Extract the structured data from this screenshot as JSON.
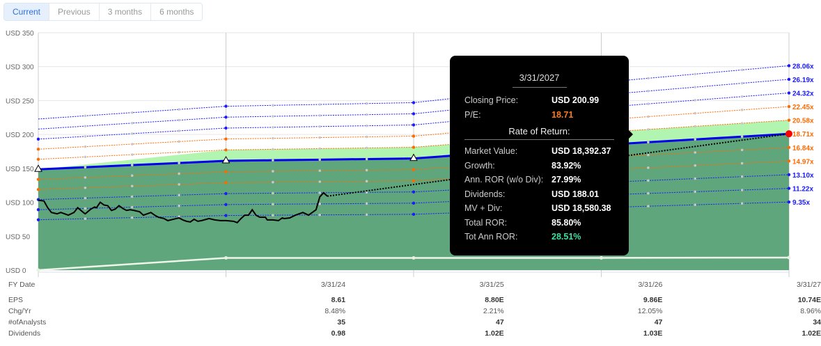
{
  "tabs": [
    {
      "label": "Current",
      "active": true
    },
    {
      "label": "Previous"
    },
    {
      "label": "3 months"
    },
    {
      "label": "6 months"
    }
  ],
  "chart_data": {
    "type": "line",
    "x_years": [
      2023,
      2024,
      2025,
      2026,
      2027
    ],
    "x_tick_labels": [
      "3/31/24",
      "3/31/25",
      "3/31/26",
      "3/31/27"
    ],
    "ylim": [
      0,
      350
    ],
    "y_ticks": [
      0,
      50,
      100,
      150,
      200,
      250,
      300,
      350
    ],
    "y_tick_labels": [
      "USD 0",
      "USD 50",
      "USD 100",
      "USD 150",
      "USD 200",
      "USD 250",
      "USD 300",
      "USD 350"
    ],
    "eps_path": [
      7.94,
      8.61,
      8.8,
      9.86,
      10.74
    ],
    "pe_multiples": [
      {
        "label": "28.06x",
        "value": 28.06,
        "color": "#1a1aff"
      },
      {
        "label": "26.19x",
        "value": 26.19,
        "color": "#1a1aff"
      },
      {
        "label": "24.32x",
        "value": 24.32,
        "color": "#1a1aff"
      },
      {
        "label": "22.45x",
        "value": 22.45,
        "color": "#ff6a00"
      },
      {
        "label": "20.58x",
        "value": 20.58,
        "color": "#ff6a00"
      },
      {
        "label": "18.71x",
        "value": 18.71,
        "color": "#ff6a00"
      },
      {
        "label": "16.84x",
        "value": 16.84,
        "color": "#ff6a00"
      },
      {
        "label": "14.97x",
        "value": 14.97,
        "color": "#ff6a00"
      },
      {
        "label": "13.10x",
        "value": 13.1,
        "color": "#1a1aff"
      },
      {
        "label": "11.22x",
        "value": 11.22,
        "color": "#1a1aff"
      },
      {
        "label": "9.35x",
        "value": 9.35,
        "color": "#1a1aff"
      }
    ],
    "fair_value_multiple": 18.71,
    "upper_band_multiple": 20.58,
    "dividend_line": [
      0,
      18,
      18,
      18,
      18.5
    ],
    "price": [
      [
        2023.0,
        103
      ],
      [
        2023.03,
        102
      ],
      [
        2023.05,
        92
      ],
      [
        2023.07,
        85
      ],
      [
        2023.1,
        83
      ],
      [
        2023.12,
        85
      ],
      [
        2023.16,
        81
      ],
      [
        2023.19,
        85
      ],
      [
        2023.21,
        92
      ],
      [
        2023.24,
        85
      ],
      [
        2023.25,
        83
      ],
      [
        2023.28,
        90
      ],
      [
        2023.3,
        93
      ],
      [
        2023.31,
        92
      ],
      [
        2023.33,
        100
      ],
      [
        2023.35,
        96
      ],
      [
        2023.37,
        95
      ],
      [
        2023.39,
        88
      ],
      [
        2023.41,
        90
      ],
      [
        2023.43,
        95
      ],
      [
        2023.45,
        91
      ],
      [
        2023.47,
        88
      ],
      [
        2023.49,
        89
      ],
      [
        2023.51,
        88
      ],
      [
        2023.54,
        86
      ],
      [
        2023.56,
        81
      ],
      [
        2023.6,
        85
      ],
      [
        2023.62,
        81
      ],
      [
        2023.64,
        78
      ],
      [
        2023.67,
        76
      ],
      [
        2023.69,
        73
      ],
      [
        2023.72,
        75
      ],
      [
        2023.75,
        77
      ],
      [
        2023.77,
        74
      ],
      [
        2023.79,
        72
      ],
      [
        2023.81,
        71
      ],
      [
        2023.83,
        75
      ],
      [
        2023.85,
        72
      ],
      [
        2023.87,
        73
      ],
      [
        2023.91,
        76
      ],
      [
        2023.94,
        74
      ],
      [
        2023.97,
        73
      ],
      [
        2024.0,
        73
      ],
      [
        2024.04,
        72
      ],
      [
        2024.06,
        70
      ],
      [
        2024.08,
        76
      ],
      [
        2024.1,
        81
      ],
      [
        2024.12,
        81
      ],
      [
        2024.14,
        89
      ],
      [
        2024.16,
        81
      ],
      [
        2024.18,
        78
      ],
      [
        2024.21,
        78
      ],
      [
        2024.22,
        74
      ],
      [
        2024.25,
        74
      ],
      [
        2024.28,
        73
      ],
      [
        2024.3,
        77
      ],
      [
        2024.31,
        76
      ],
      [
        2024.34,
        77
      ],
      [
        2024.37,
        81
      ],
      [
        2024.41,
        85
      ],
      [
        2024.44,
        81
      ],
      [
        2024.48,
        89
      ],
      [
        2024.5,
        108
      ],
      [
        2024.52,
        114
      ],
      [
        2024.54,
        109
      ]
    ],
    "projection_end": [
      2027,
      200.99
    ],
    "colors": {
      "dark_green": "#5fa67c",
      "light_green": "#b2f5b0",
      "fair_line": "#0000ee",
      "price": "#000000",
      "dividend": "#f0f5ea",
      "marker_end": "#ff0000"
    }
  },
  "tooltip": {
    "date": "3/31/2027",
    "closing_price_label": "Closing Price:",
    "closing_price": "USD 200.99",
    "pe_label": "P/E:",
    "pe": "18.71",
    "section": "Rate of Return:",
    "rows": [
      {
        "k": "Market Value:",
        "v": "USD 18,392.37"
      },
      {
        "k": "Growth:",
        "v": "83.92%"
      },
      {
        "k": "Ann. ROR (w/o Div):",
        "v": "27.99%"
      },
      {
        "k": "Dividends:",
        "v": "USD 188.01"
      },
      {
        "k": "MV + Div:",
        "v": "USD 18,580.38"
      },
      {
        "k": "Total ROR:",
        "v": "85.80%"
      },
      {
        "k": "Tot Ann ROR:",
        "v": "28.51%"
      }
    ],
    "pe_color": "#ff7a1a",
    "tot_ann_color": "#3ee0a0"
  },
  "fy_table": {
    "header": {
      "label": "FY Date",
      "values": [
        "3/31/24",
        "3/31/25",
        "3/31/26",
        "3/31/27"
      ]
    },
    "rows": [
      {
        "label": "EPS",
        "values": [
          "8.61",
          "8.80E",
          "9.86E",
          "10.74E"
        ],
        "bold": true
      },
      {
        "label": "Chg/Yr",
        "values": [
          "8.48%",
          "2.21%",
          "12.05%",
          "8.96%"
        ],
        "bold": false
      },
      {
        "label": "#ofAnalysts",
        "values": [
          "35",
          "47",
          "47",
          "34"
        ],
        "bold": true
      },
      {
        "label": "Dividends",
        "values": [
          "0.98",
          "1.02E",
          "1.03E",
          "1.02E"
        ],
        "bold": true
      }
    ]
  }
}
